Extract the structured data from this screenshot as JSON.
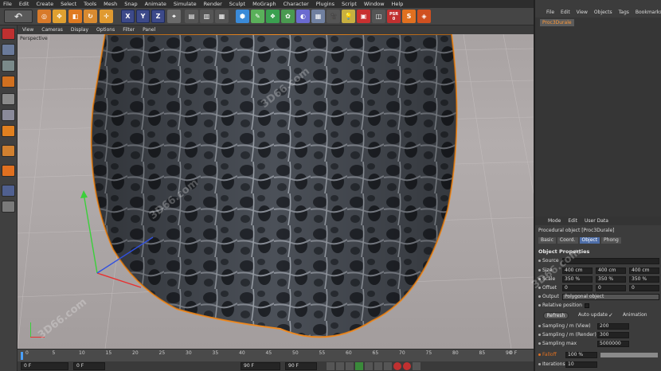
{
  "menubar": [
    "File",
    "Edit",
    "Create",
    "Select",
    "Tools",
    "Mesh",
    "Snap",
    "Animate",
    "Simulate",
    "Render",
    "Sculpt",
    "MoGraph",
    "Character",
    "Plugins",
    "Script",
    "Window",
    "Help"
  ],
  "toolbar": {
    "axis_x": "X",
    "axis_y": "Y",
    "axis_z": "Z",
    "psr_label": "PSR",
    "psr_value": "0"
  },
  "viewport": {
    "menu": [
      "View",
      "Cameras",
      "Display",
      "Options",
      "Filter",
      "Panel"
    ],
    "label": "Perspective"
  },
  "timeline": {
    "ticks": [
      "0",
      "5",
      "10",
      "15",
      "20",
      "25",
      "30",
      "35",
      "40",
      "45",
      "50",
      "55",
      "60",
      "65",
      "70",
      "75",
      "80",
      "85",
      "90"
    ],
    "end_marker": "0 F",
    "current_frame": "0 F",
    "start_frame": "0 F",
    "end_frame_a": "90 F",
    "end_frame_b": "90 F"
  },
  "objects_panel": {
    "menu": [
      "File",
      "Edit",
      "View",
      "Objects",
      "Tags",
      "Bookmarks"
    ],
    "item": "Proc3Durale"
  },
  "attributes": {
    "menu": [
      "Mode",
      "Edit",
      "User Data"
    ],
    "title": "Procedural object [Proc3Durale]",
    "tabs": [
      "Basic",
      "Coord.",
      "Object",
      "Phong"
    ],
    "section": "Object Properties",
    "source_label": "Source",
    "size_label": "Size",
    "size": [
      "400 cm",
      "400 cm",
      "400 cm"
    ],
    "scale_label": "Scale",
    "scale": [
      "350 %",
      "350 %",
      "350 %"
    ],
    "offset_label": "Offset",
    "offset": [
      "0",
      "0",
      "0"
    ],
    "output_label": "Output",
    "output_value": "Polygonal object",
    "relpos_label": "Relative position",
    "refresh_label": "Refresh",
    "auto_update_label": "Auto update",
    "animation_label": "Animation",
    "sampling_view_label": "Sampling / m (View)",
    "sampling_view": "200",
    "sampling_render_label": "Sampling / m (Render)",
    "sampling_render": "300",
    "sampling_max_label": "Sampling max",
    "sampling_max": "5000000",
    "falloff_label": "Falloff",
    "falloff": "100 %",
    "iterations_label": "Iterations",
    "iterations": "10"
  },
  "watermarks": [
    "3D66.com",
    "3D66.com",
    "3D66.com",
    "3D66.com"
  ]
}
